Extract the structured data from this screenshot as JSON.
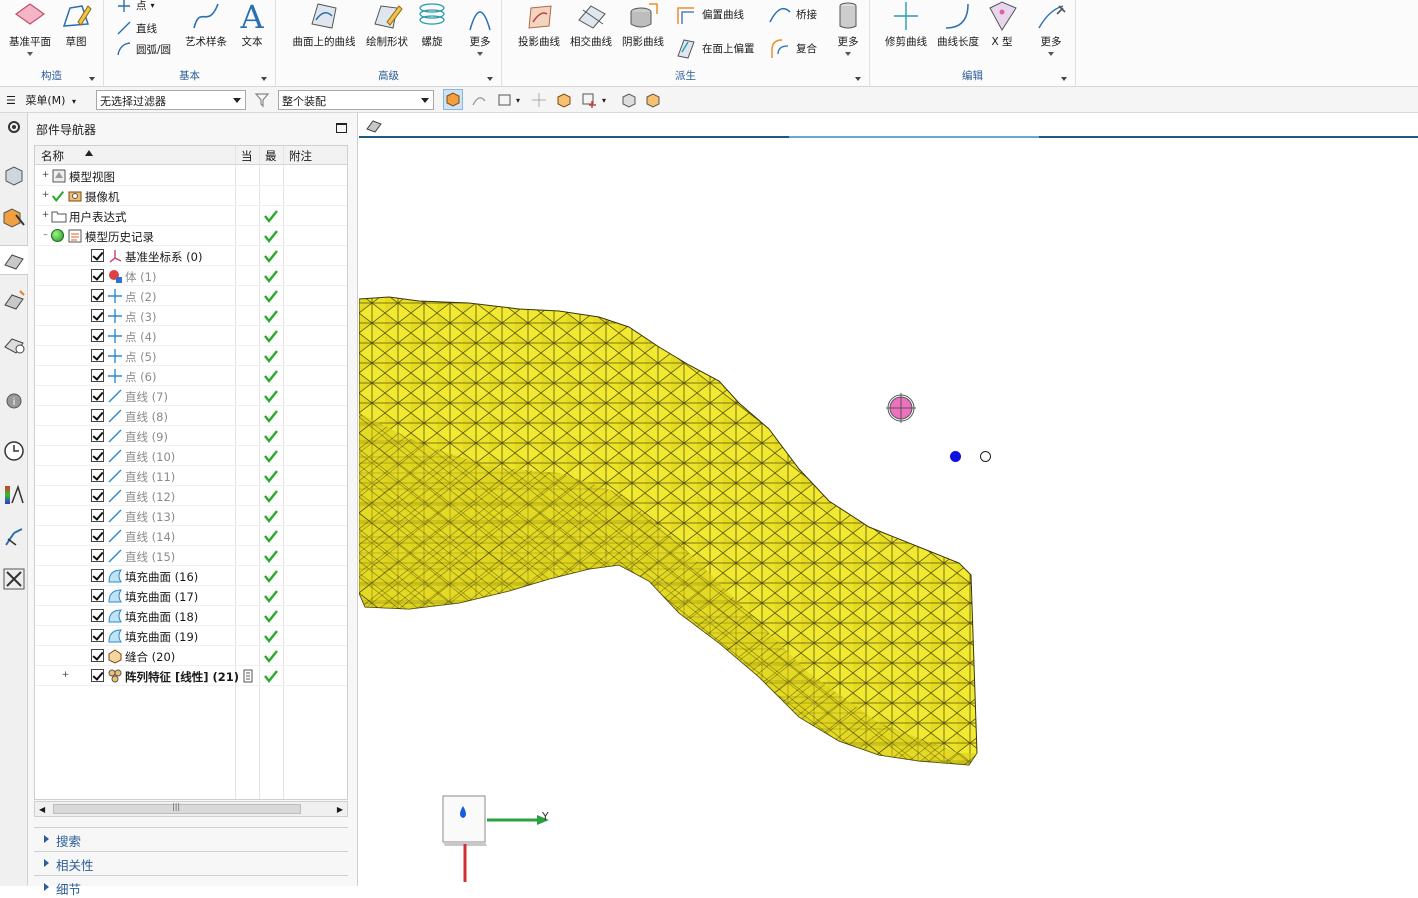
{
  "ribbon": {
    "groups": [
      {
        "label": "构造",
        "buttons": [
          {
            "label": "基准平面"
          },
          {
            "label": "草图"
          }
        ]
      },
      {
        "label": "基本",
        "small": [
          {
            "label": "点"
          },
          {
            "label": "直线"
          },
          {
            "label": "圆弧/圆"
          }
        ],
        "buttons": [
          {
            "label": "艺术样条"
          },
          {
            "label": "文本"
          }
        ]
      },
      {
        "label": "高级",
        "buttons": [
          {
            "label": "曲面上的曲线"
          },
          {
            "label": "绘制形状"
          },
          {
            "label": "螺旋"
          },
          {
            "label": "更多"
          }
        ]
      },
      {
        "label": "派生",
        "buttons": [
          {
            "label": "投影曲线"
          },
          {
            "label": "相交曲线"
          },
          {
            "label": "阴影曲线"
          }
        ],
        "small": [
          {
            "label": "偏置曲线"
          },
          {
            "label": "在面上偏置"
          },
          {
            "label": "桥接"
          },
          {
            "label": "复合"
          }
        ],
        "more": "更多"
      },
      {
        "label": "编辑",
        "buttons": [
          {
            "label": "修剪曲线"
          },
          {
            "label": "曲线长度"
          },
          {
            "label": "X 型"
          },
          {
            "label": "更多"
          }
        ]
      }
    ]
  },
  "toolbar": {
    "menu_label": "菜单(M)",
    "filter_value": "无选择过滤器",
    "assembly_value": "整个装配"
  },
  "navigator": {
    "title": "部件导航器",
    "columns": [
      "名称",
      "当",
      "最",
      "附注"
    ],
    "rows": [
      {
        "name": "模型视图",
        "icon": "model-views-icon",
        "level": 0,
        "expand": "+",
        "check": false,
        "ok": false,
        "dim": false
      },
      {
        "name": "摄像机",
        "icon": "camera-icon",
        "level": 0,
        "expand": "+",
        "check": false,
        "ok": false,
        "dim": false,
        "greencheck": true
      },
      {
        "name": "用户表达式",
        "icon": "folder-icon",
        "level": 0,
        "expand": "+",
        "check": false,
        "ok": true,
        "dim": false
      },
      {
        "name": "模型历史记录",
        "icon": "history-icon",
        "level": 0,
        "expand": "–",
        "check": false,
        "ok": true,
        "dim": false,
        "greendot": true
      },
      {
        "name": "基准坐标系 (0)",
        "icon": "datum-csys-icon",
        "level": 1,
        "check": true,
        "ok": true,
        "dim": false
      },
      {
        "name": "体 (1)",
        "icon": "body-icon",
        "level": 1,
        "check": true,
        "ok": true,
        "dim": true
      },
      {
        "name": "点 (2)",
        "icon": "point-icon",
        "level": 1,
        "check": true,
        "ok": true,
        "dim": true
      },
      {
        "name": "点 (3)",
        "icon": "point-icon",
        "level": 1,
        "check": true,
        "ok": true,
        "dim": true
      },
      {
        "name": "点 (4)",
        "icon": "point-icon",
        "level": 1,
        "check": true,
        "ok": true,
        "dim": true
      },
      {
        "name": "点 (5)",
        "icon": "point-icon",
        "level": 1,
        "check": true,
        "ok": true,
        "dim": true
      },
      {
        "name": "点 (6)",
        "icon": "point-icon",
        "level": 1,
        "check": true,
        "ok": true,
        "dim": true
      },
      {
        "name": "直线 (7)",
        "icon": "line-icon",
        "level": 1,
        "check": true,
        "ok": true,
        "dim": true
      },
      {
        "name": "直线 (8)",
        "icon": "line-icon",
        "level": 1,
        "check": true,
        "ok": true,
        "dim": true
      },
      {
        "name": "直线 (9)",
        "icon": "line-icon",
        "level": 1,
        "check": true,
        "ok": true,
        "dim": true
      },
      {
        "name": "直线 (10)",
        "icon": "line-icon",
        "level": 1,
        "check": true,
        "ok": true,
        "dim": true
      },
      {
        "name": "直线 (11)",
        "icon": "line-icon",
        "level": 1,
        "check": true,
        "ok": true,
        "dim": true
      },
      {
        "name": "直线 (12)",
        "icon": "line-icon",
        "level": 1,
        "check": true,
        "ok": true,
        "dim": true
      },
      {
        "name": "直线 (13)",
        "icon": "line-icon",
        "level": 1,
        "check": true,
        "ok": true,
        "dim": true
      },
      {
        "name": "直线 (14)",
        "icon": "line-icon",
        "level": 1,
        "check": true,
        "ok": true,
        "dim": true
      },
      {
        "name": "直线 (15)",
        "icon": "line-icon",
        "level": 1,
        "check": true,
        "ok": true,
        "dim": true
      },
      {
        "name": "填充曲面 (16)",
        "icon": "fill-surface-icon",
        "level": 1,
        "check": true,
        "ok": true,
        "dim": false
      },
      {
        "name": "填充曲面 (17)",
        "icon": "fill-surface-icon",
        "level": 1,
        "check": true,
        "ok": true,
        "dim": false
      },
      {
        "name": "填充曲面 (18)",
        "icon": "fill-surface-icon",
        "level": 1,
        "check": true,
        "ok": true,
        "dim": false
      },
      {
        "name": "填充曲面 (19)",
        "icon": "fill-surface-icon",
        "level": 1,
        "check": true,
        "ok": true,
        "dim": false
      },
      {
        "name": "缝合 (20)",
        "icon": "sew-icon",
        "level": 1,
        "check": true,
        "ok": true,
        "dim": false
      },
      {
        "name": "阵列特征 [线性] (21)",
        "icon": "pattern-feature-icon",
        "level": 1,
        "expand": "+",
        "check": true,
        "ok": true,
        "dim": false,
        "bold": true,
        "note": true
      }
    ],
    "sections": [
      "搜索",
      "相关性",
      "细节"
    ]
  },
  "viewport": {
    "axis_y_label": "Y"
  }
}
